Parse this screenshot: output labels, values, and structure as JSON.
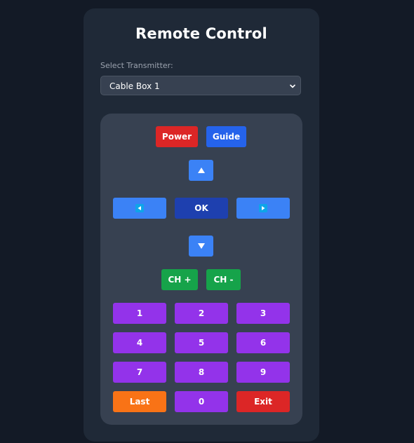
{
  "title": "Remote Control",
  "transmitter": {
    "label": "Select Transmitter:",
    "selected": "Cable Box 1"
  },
  "buttons": {
    "power": "Power",
    "guide": "Guide",
    "ok": "OK",
    "ch_up": "CH +",
    "ch_down": "CH -",
    "numbers": [
      "1",
      "2",
      "3",
      "4",
      "5",
      "6",
      "7",
      "8",
      "9"
    ],
    "last": "Last",
    "zero": "0",
    "exit": "Exit"
  },
  "icons": {
    "up": "triangle-up-icon",
    "down": "triangle-down-icon",
    "left": "arrow-left-icon",
    "right": "arrow-right-icon",
    "select": "chevron-down-icon"
  },
  "colors": {
    "power": "#dc2626",
    "guide": "#2563eb",
    "nav": "#3b82f6",
    "ok": "#1e40af",
    "channel": "#16a34a",
    "number": "#9333ea",
    "last": "#f97316",
    "exit": "#dc2626"
  }
}
